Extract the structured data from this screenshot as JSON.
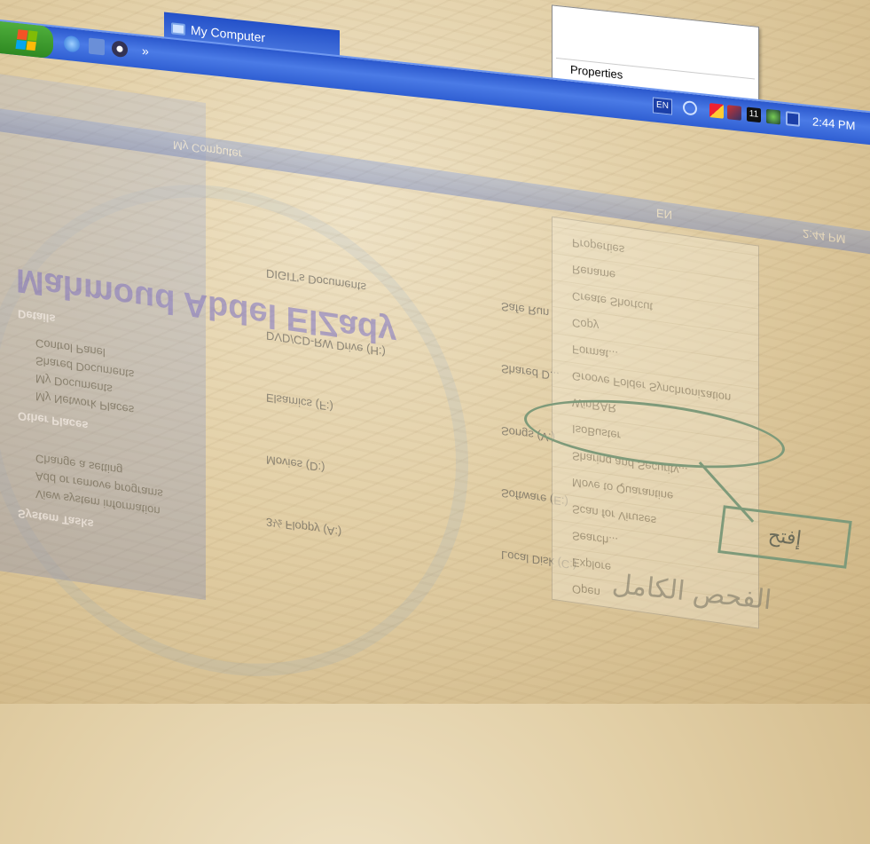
{
  "taskbar": {
    "window_title": "My Computer",
    "language": "EN",
    "clock": "2:44 PM",
    "calendar_day": "11"
  },
  "top_context_menu": {
    "items": [
      "Properties"
    ]
  },
  "reflection": {
    "user_title": "Mahmoud Abdel ElZady",
    "window_title": "My Computer",
    "sidebar": {
      "system_tasks": "System Tasks",
      "task_items": [
        "View system information",
        "Add or remove programs",
        "Change a setting"
      ],
      "other_places_header": "Other Places",
      "other_places": [
        "My Network Places",
        "My Documents",
        "Shared Documents",
        "Control Panel"
      ],
      "details_header": "Details"
    },
    "drives": [
      "DIGIT's Documents",
      "DVD/CD-RW Drive (H:)",
      "Elsamics (F:)",
      "Movies (D:)",
      "3½ Floppy (A:)"
    ],
    "drives_col2": [
      "Safe Run",
      "Shared D...",
      "Songs (V:)",
      "Software (E:)",
      "Local Disk (C:)"
    ],
    "context_menu": [
      "Open",
      "Explore",
      "Search...",
      "Scan for Viruses",
      "Move to Quarantine",
      "Sharing and Security...",
      "IsoBuster",
      "WinRAR",
      "Groove Folder Synchronization",
      "Format...",
      "Copy",
      "Create Shortcut",
      "Rename",
      "Properties"
    ],
    "clock": "2:44 PM",
    "language": "EN"
  },
  "annotation": {
    "note": "إفتح",
    "sub_note": "الفحص الكامل"
  },
  "colors": {
    "taskbar_blue": "#2a57cc",
    "start_green": "#2f8a22",
    "annotation_green": "#7e9a7a"
  }
}
